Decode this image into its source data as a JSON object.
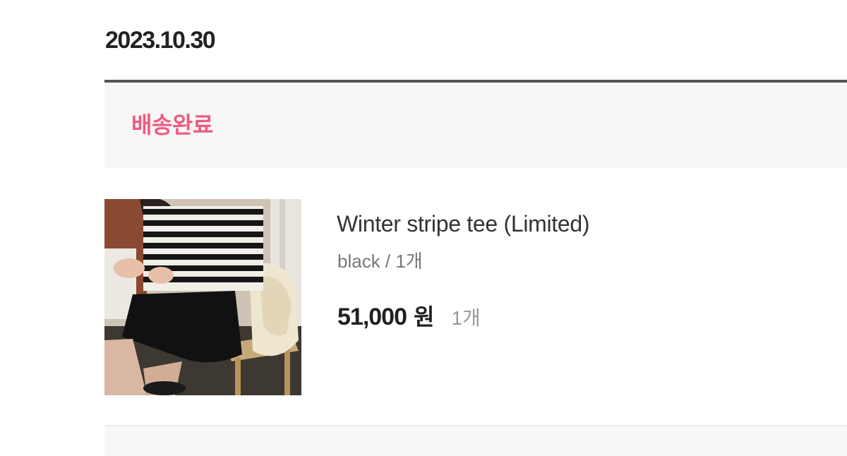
{
  "order": {
    "date": "2023.10.30",
    "status": "배송완료",
    "status_color": "#ef5b7f"
  },
  "product": {
    "image_alt": "woman wearing black and white striped tee",
    "name": "Winter stripe tee (Limited)",
    "option": "black / 1개",
    "price": "51,000",
    "currency": "원",
    "quantity": "1개"
  }
}
